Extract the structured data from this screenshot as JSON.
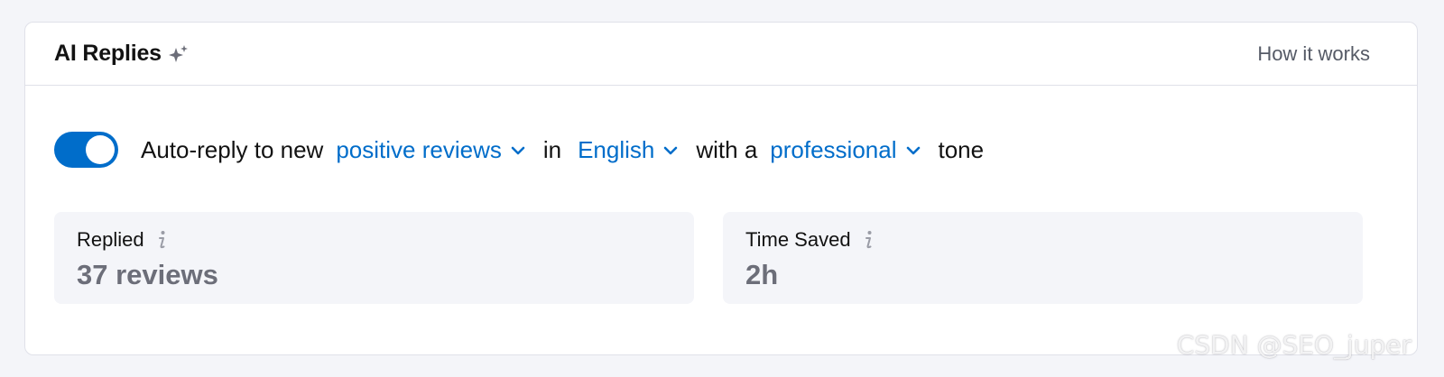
{
  "header": {
    "title": "AI Replies",
    "title_icon": "sparkle-icon",
    "how_link": "How it works"
  },
  "rule": {
    "enabled": true,
    "prefix": "Auto-reply to new",
    "review_type": "positive reviews",
    "in_text": "in",
    "language": "English",
    "with_text": "with a",
    "tone": "professional",
    "suffix": "tone"
  },
  "stats": [
    {
      "label": "Replied",
      "value": "37 reviews",
      "icon": "info-icon"
    },
    {
      "label": "Time Saved",
      "value": "2h",
      "icon": "info-icon"
    }
  ],
  "watermark": "CSDN @SEO_juper",
  "colors": {
    "accent": "#006dca",
    "card_bg": "#ffffff",
    "page_bg": "#f4f5f9",
    "stat_bg": "#f4f5f9",
    "stat_value": "#6c6e79"
  }
}
